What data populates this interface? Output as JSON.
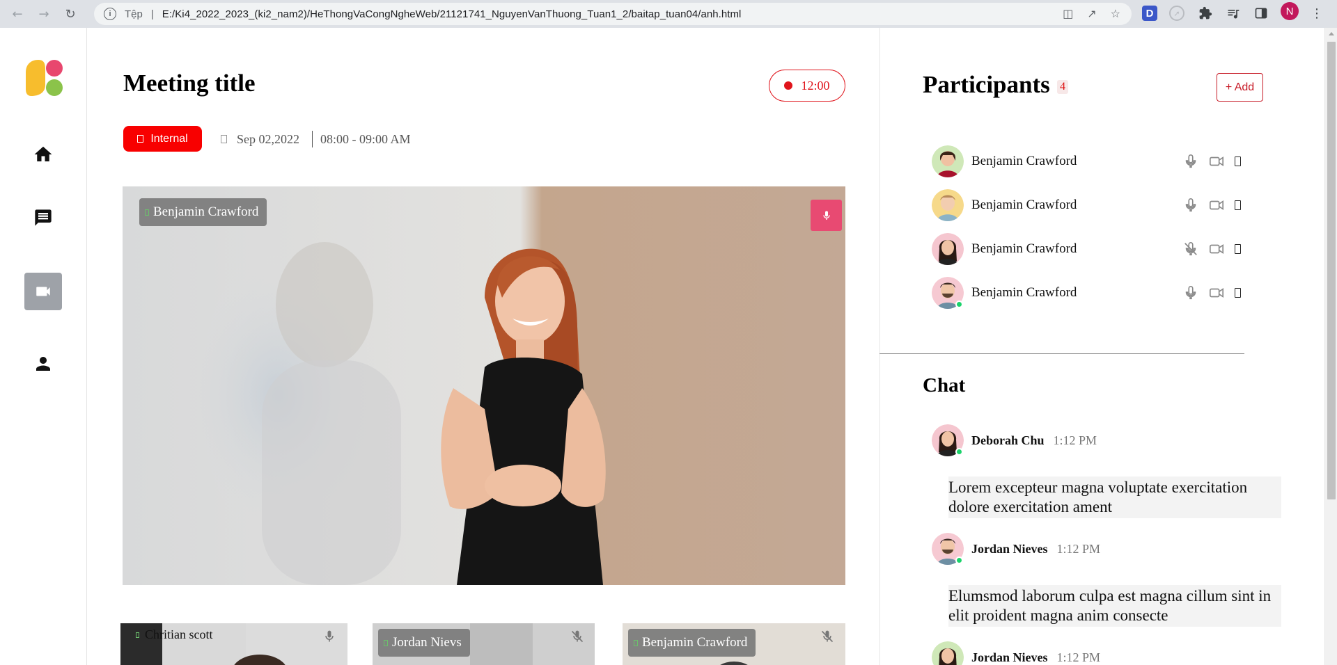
{
  "browser": {
    "scheme": "Tệp",
    "url": "E:/Ki4_2022_2023_(ki2_nam2)/HeThongVaCongNgheWeb/21121741_NguyenVanThuong_Tuan1_2/baitap_tuan04/anh.html",
    "profile_initial": "N",
    "extension_letter": "D"
  },
  "nav": {
    "items": [
      {
        "name": "home",
        "icon": "home-icon"
      },
      {
        "name": "messages",
        "icon": "chat-icon"
      },
      {
        "name": "video",
        "icon": "video-camera-icon",
        "active": true
      },
      {
        "name": "profile",
        "icon": "person-icon"
      }
    ]
  },
  "meeting": {
    "title": "Meeting title",
    "timer": "12:00",
    "tag": "Internal",
    "date": "Sep 02,2022",
    "time_range": "08:00 - 09:00 AM",
    "main_speaker": "Benjamin Crawford",
    "thumbnails": [
      {
        "name": "Chritian scott",
        "muted": false
      },
      {
        "name": "Jordan Nievs",
        "muted": true
      },
      {
        "name": "Benjamin Crawford",
        "muted": true
      }
    ]
  },
  "participants": {
    "title": "Participants",
    "count": "4",
    "add_label": "+ Add",
    "list": [
      {
        "name": "Benjamin Crawford",
        "muted": false,
        "online": false
      },
      {
        "name": "Benjamin Crawford",
        "muted": false,
        "online": false
      },
      {
        "name": "Benjamin Crawford",
        "muted": true,
        "online": false
      },
      {
        "name": "Benjamin Crawford",
        "muted": false,
        "online": true
      }
    ]
  },
  "chat": {
    "title": "Chat",
    "messages": [
      {
        "author": "Deborah Chu",
        "time": "1:12 PM",
        "text": "Lorem excepteur magna voluptate exercitation dolore exercitation ament"
      },
      {
        "author": "Jordan Nieves",
        "time": "1:12 PM",
        "text": "Elumsmod laborum culpa est magna cillum sint in elit proident magna anim consecte"
      },
      {
        "author": "Jordan Nieves",
        "time": "1:12 PM",
        "text": ""
      }
    ]
  },
  "colors": {
    "accent_red": "#f80000",
    "record_red": "#e0141b",
    "mic_pink": "#e84a72",
    "online_green": "#1bd36b",
    "nav_active": "#9ea2a8"
  }
}
